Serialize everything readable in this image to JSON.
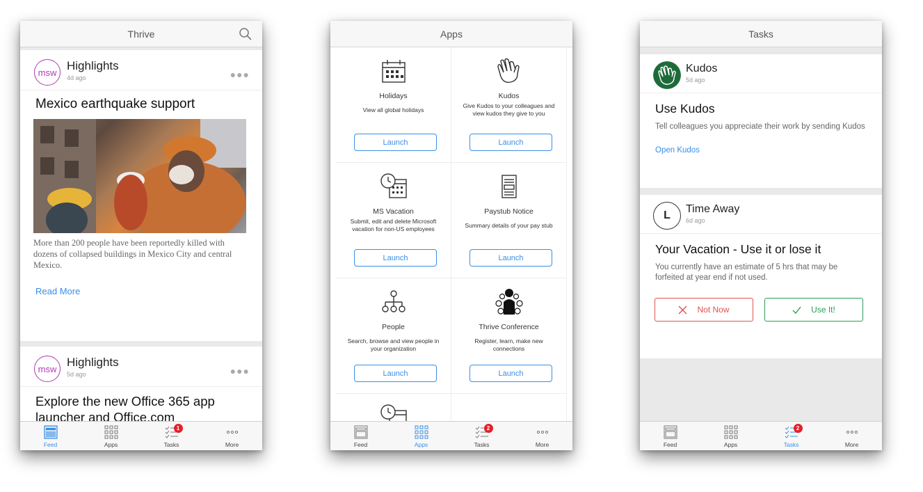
{
  "colors": {
    "accent": "#3a8ee6",
    "msw": "#b03ab5",
    "badge": "#e4202a",
    "kudos_green": "#1e6b3a",
    "not_now": "#e05252",
    "use_it": "#2e9a5a"
  },
  "screens": {
    "feed": {
      "title": "Thrive",
      "cards": [
        {
          "avatar": "msw",
          "source": "Highlights",
          "time": "4d ago",
          "headline": "Mexico earthquake support",
          "blurb": "More than 200 people have been reportedly killed with dozens of collapsed buildings in Mexico City and central Mexico.",
          "link": "Read More"
        },
        {
          "avatar": "msw",
          "source": "Highlights",
          "time": "5d ago",
          "headline": "Explore the new Office 365 app launcher and Office.com"
        }
      ]
    },
    "apps": {
      "title": "Apps",
      "items": [
        {
          "name": "Holidays",
          "desc": "View all global holidays",
          "button": "Launch",
          "icon": "calendar-icon"
        },
        {
          "name": "Kudos",
          "desc": "Give Kudos to your colleagues and view kudos they give to you",
          "button": "Launch",
          "icon": "clapping-hands-icon"
        },
        {
          "name": "MS Vacation",
          "desc": "Submit, edit and delete Microsoft vacation for non-US employees",
          "button": "Launch",
          "icon": "clock-calendar-icon"
        },
        {
          "name": "Paystub Notice",
          "desc": "Summary details of your pay stub",
          "button": "Launch",
          "icon": "document-icon"
        },
        {
          "name": "People",
          "desc": "Search, browse and view people in your organization",
          "button": "Launch",
          "icon": "org-chart-icon"
        },
        {
          "name": "Thrive Conference",
          "desc": "Register, learn, make new connections",
          "button": "Launch",
          "icon": "conference-icon"
        }
      ]
    },
    "tasks": {
      "title": "Tasks",
      "cards": [
        {
          "source": "Kudos",
          "time": "5d ago",
          "title": "Use Kudos",
          "body": "Tell colleagues you appreciate their work by sending Kudos",
          "link": "Open Kudos"
        },
        {
          "source": "Time Away",
          "avatar_letter": "L",
          "time": "6d ago",
          "title": "Your Vacation - Use it or lose it",
          "body": "You currently have an estimate of 5 hrs that may be forfeited at year end if not used.",
          "decline": "Not Now",
          "accept": "Use It!"
        }
      ]
    }
  },
  "tabbar": {
    "feed": "Feed",
    "apps": "Apps",
    "tasks": "Tasks",
    "more": "More",
    "tasks_badge": "1",
    "tasks_badge_2": "2"
  }
}
